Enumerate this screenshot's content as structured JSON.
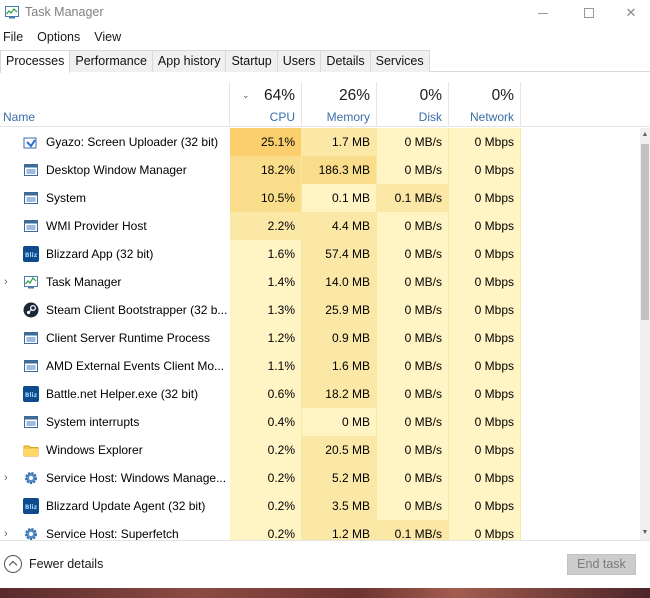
{
  "window": {
    "title": "Task Manager"
  },
  "menu": [
    "File",
    "Options",
    "View"
  ],
  "tabs": [
    {
      "label": "Processes",
      "active": true
    },
    {
      "label": "Performance"
    },
    {
      "label": "App history"
    },
    {
      "label": "Startup"
    },
    {
      "label": "Users"
    },
    {
      "label": "Details"
    },
    {
      "label": "Services"
    }
  ],
  "columns": {
    "name": {
      "label": "Name"
    },
    "cpu": {
      "pct": "64%",
      "label": "CPU"
    },
    "memory": {
      "pct": "26%",
      "label": "Memory"
    },
    "disk": {
      "pct": "0%",
      "label": "Disk"
    },
    "network": {
      "pct": "0%",
      "label": "Network"
    }
  },
  "processes": [
    {
      "name": "Gyazo: Screen Uploader (32 bit)",
      "cpu": "25.1%",
      "memory": "1.7 MB",
      "disk": "0 MB/s",
      "network": "0 Mbps",
      "icon": "gyazo-icon",
      "expandable": false
    },
    {
      "name": "Desktop Window Manager",
      "cpu": "18.2%",
      "memory": "186.3 MB",
      "disk": "0 MB/s",
      "network": "0 Mbps",
      "icon": "window-icon",
      "expandable": false
    },
    {
      "name": "System",
      "cpu": "10.5%",
      "memory": "0.1 MB",
      "disk": "0.1 MB/s",
      "network": "0 Mbps",
      "icon": "window-icon",
      "expandable": false
    },
    {
      "name": "WMI Provider Host",
      "cpu": "2.2%",
      "memory": "4.4 MB",
      "disk": "0 MB/s",
      "network": "0 Mbps",
      "icon": "window-icon",
      "expandable": false
    },
    {
      "name": "Blizzard App (32 bit)",
      "cpu": "1.6%",
      "memory": "57.4 MB",
      "disk": "0 MB/s",
      "network": "0 Mbps",
      "icon": "blizzard-icon",
      "expandable": false
    },
    {
      "name": "Task Manager",
      "cpu": "1.4%",
      "memory": "14.0 MB",
      "disk": "0 MB/s",
      "network": "0 Mbps",
      "icon": "task-manager-icon",
      "expandable": true
    },
    {
      "name": "Steam Client Bootstrapper (32 b...",
      "cpu": "1.3%",
      "memory": "25.9 MB",
      "disk": "0 MB/s",
      "network": "0 Mbps",
      "icon": "steam-icon",
      "expandable": false
    },
    {
      "name": "Client Server Runtime Process",
      "cpu": "1.2%",
      "memory": "0.9 MB",
      "disk": "0 MB/s",
      "network": "0 Mbps",
      "icon": "window-icon",
      "expandable": false
    },
    {
      "name": "AMD External Events Client Mo...",
      "cpu": "1.1%",
      "memory": "1.6 MB",
      "disk": "0 MB/s",
      "network": "0 Mbps",
      "icon": "window-icon",
      "expandable": false
    },
    {
      "name": "Battle.net Helper.exe (32 bit)",
      "cpu": "0.6%",
      "memory": "18.2 MB",
      "disk": "0 MB/s",
      "network": "0 Mbps",
      "icon": "battlenet-icon",
      "expandable": false
    },
    {
      "name": "System interrupts",
      "cpu": "0.4%",
      "memory": "0 MB",
      "disk": "0 MB/s",
      "network": "0 Mbps",
      "icon": "window-icon",
      "expandable": false
    },
    {
      "name": "Windows Explorer",
      "cpu": "0.2%",
      "memory": "20.5 MB",
      "disk": "0 MB/s",
      "network": "0 Mbps",
      "icon": "folder-icon",
      "expandable": false
    },
    {
      "name": "Service Host: Windows Manage...",
      "cpu": "0.2%",
      "memory": "5.2 MB",
      "disk": "0 MB/s",
      "network": "0 Mbps",
      "icon": "gear-icon",
      "expandable": true
    },
    {
      "name": "Blizzard Update Agent (32 bit)",
      "cpu": "0.2%",
      "memory": "3.5 MB",
      "disk": "0 MB/s",
      "network": "0 Mbps",
      "icon": "blizzard-icon",
      "expandable": false
    },
    {
      "name": "Service Host: Superfetch",
      "cpu": "0.2%",
      "memory": "1.2 MB",
      "disk": "0.1 MB/s",
      "network": "0 Mbps",
      "icon": "gear-icon",
      "expandable": true
    }
  ],
  "footer": {
    "fewer_details": "Fewer details",
    "end_task": "End task"
  },
  "colors": {
    "heat_low": "#fff4c4",
    "heat_mid": "#fbe8a6",
    "heat_high": "#f9dd8a",
    "heat_max": "#fbcf6d",
    "accent": "#3b6ea8"
  }
}
